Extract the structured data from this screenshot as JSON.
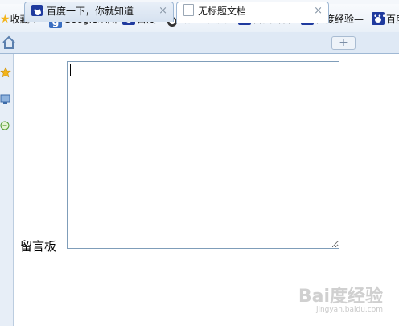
{
  "bookmarks": {
    "favorites_label": "收藏",
    "items": [
      {
        "label": "Google地图",
        "icon": "google-icon"
      },
      {
        "label": "百度",
        "icon": "baidu-paw-icon"
      },
      {
        "label": "专题 - 天天",
        "icon": "topic-icon"
      },
      {
        "label": "百度百科",
        "icon": "baidu-paw-icon"
      },
      {
        "label": "百度经验—",
        "icon": "baidu-paw-icon"
      },
      {
        "label": "百度",
        "icon": "baidu-paw-icon"
      }
    ]
  },
  "tabs": [
    {
      "title": "百度一下，你就知道",
      "active": false
    },
    {
      "title": "无标题文档",
      "active": true
    }
  ],
  "tab_close_glyph": "×",
  "new_tab_glyph": "+",
  "page": {
    "field_label": "留言板",
    "textarea_value": ""
  },
  "watermark": {
    "text": "Bai度经验",
    "url": "jingyan.baidu.com"
  },
  "colors": {
    "textarea_border": "#7f9db9",
    "tabbar_bg": "#dfe9f5",
    "baidu_blue": "#1f3a9e"
  }
}
